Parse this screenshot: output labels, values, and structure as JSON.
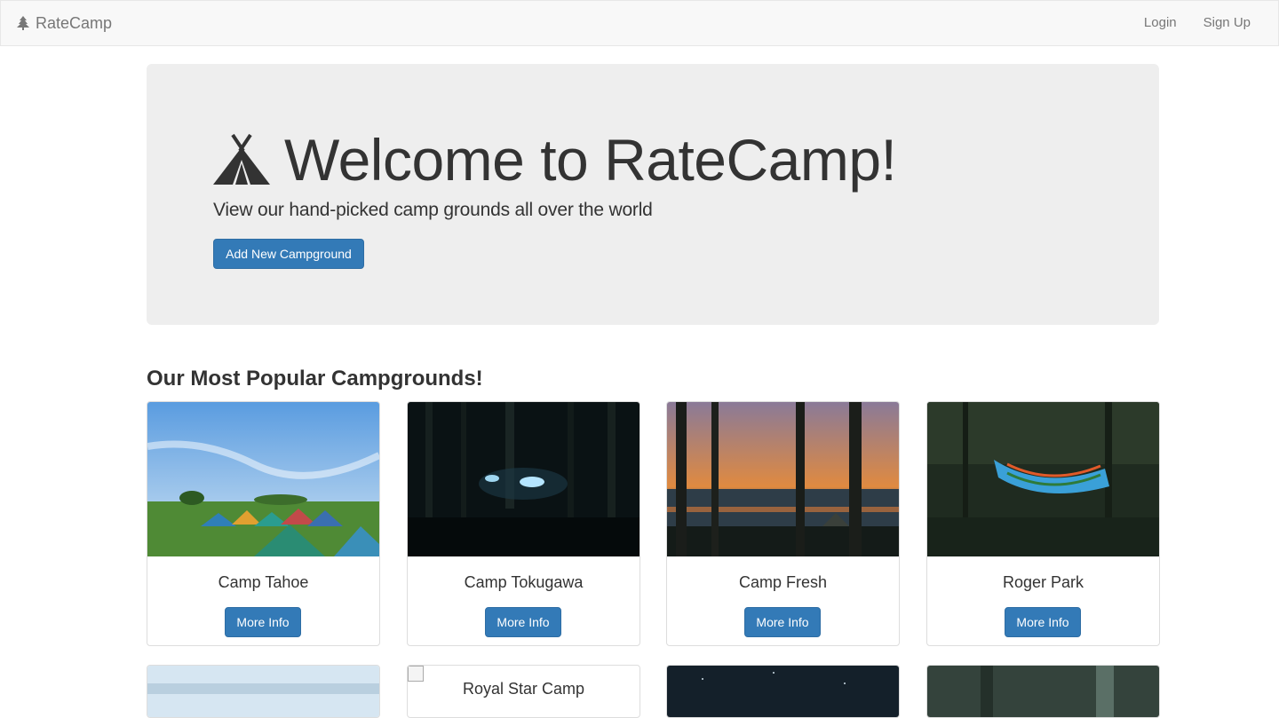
{
  "navbar": {
    "brand": "RateCamp",
    "login": "Login",
    "signup": "Sign Up"
  },
  "jumbotron": {
    "heading": "Welcome to RateCamp!",
    "lead": "View our hand-picked camp grounds all over the world",
    "add_button": "Add New Campground"
  },
  "section": {
    "heading": "Our Most Popular Campgrounds!"
  },
  "campgrounds": [
    {
      "name": "Camp Tahoe",
      "button": "More Info"
    },
    {
      "name": "Camp Tokugawa",
      "button": "More Info"
    },
    {
      "name": "Camp Fresh",
      "button": "More Info"
    },
    {
      "name": "Roger Park",
      "button": "More Info"
    }
  ],
  "campgrounds_row2": [
    {
      "name": ""
    },
    {
      "name": "Royal Star Camp"
    },
    {
      "name": ""
    },
    {
      "name": ""
    }
  ],
  "colors": {
    "primary": "#337ab7",
    "jumbotron_bg": "#eeeeee",
    "navbar_bg": "#f8f8f8"
  }
}
